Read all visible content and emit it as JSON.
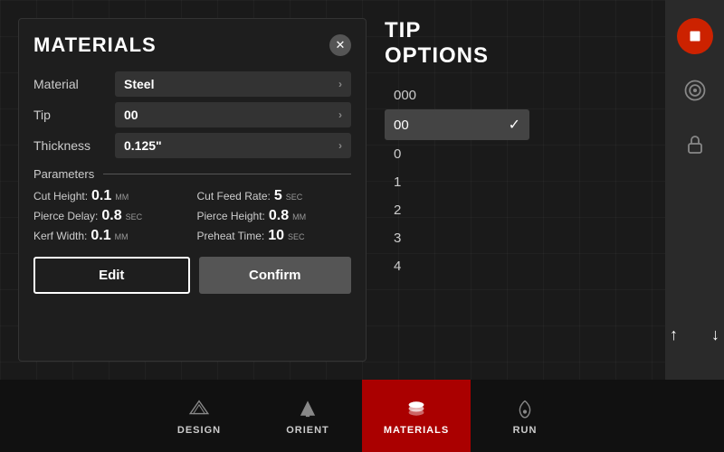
{
  "materials_panel": {
    "title": "MATERIALS",
    "close_label": "✕",
    "fields": [
      {
        "label": "Material",
        "value": "Steel"
      },
      {
        "label": "Tip",
        "value": "00"
      },
      {
        "label": "Thickness",
        "value": "0.125\""
      }
    ],
    "parameters_label": "Parameters",
    "params": [
      {
        "name": "Cut Height:",
        "value": "0.1",
        "unit": "MM"
      },
      {
        "name": "Cut Feed Rate:",
        "value": "5",
        "unit": "SEC"
      },
      {
        "name": "Pierce Delay:",
        "value": "0.8",
        "unit": "SEC"
      },
      {
        "name": "Pierce Height:",
        "value": "0.8",
        "unit": "MM"
      },
      {
        "name": "Kerf Width:",
        "value": "0.1",
        "unit": "MM"
      },
      {
        "name": "Preheat Time:",
        "value": "10",
        "unit": "SEC"
      }
    ],
    "edit_label": "Edit",
    "confirm_label": "Confirm"
  },
  "tip_options": {
    "title": "TIP OPTIONS",
    "items": [
      {
        "value": "000",
        "selected": false
      },
      {
        "value": "00",
        "selected": true
      },
      {
        "value": "0",
        "selected": false
      },
      {
        "value": "1",
        "selected": false
      },
      {
        "value": "2",
        "selected": false
      },
      {
        "value": "3",
        "selected": false
      },
      {
        "value": "4",
        "selected": false
      }
    ]
  },
  "bottom_nav": {
    "items": [
      {
        "label": "DESIGN",
        "icon": "design"
      },
      {
        "label": "ORIENT",
        "icon": "orient"
      },
      {
        "label": "MATERIALS",
        "icon": "materials",
        "active": true
      },
      {
        "label": "RUN",
        "icon": "run"
      }
    ]
  },
  "sidebar": {
    "stop_icon": "stop",
    "target_icon": "target",
    "lock_icon": "lock",
    "up_icon": "↑",
    "down_icon": "↓"
  }
}
